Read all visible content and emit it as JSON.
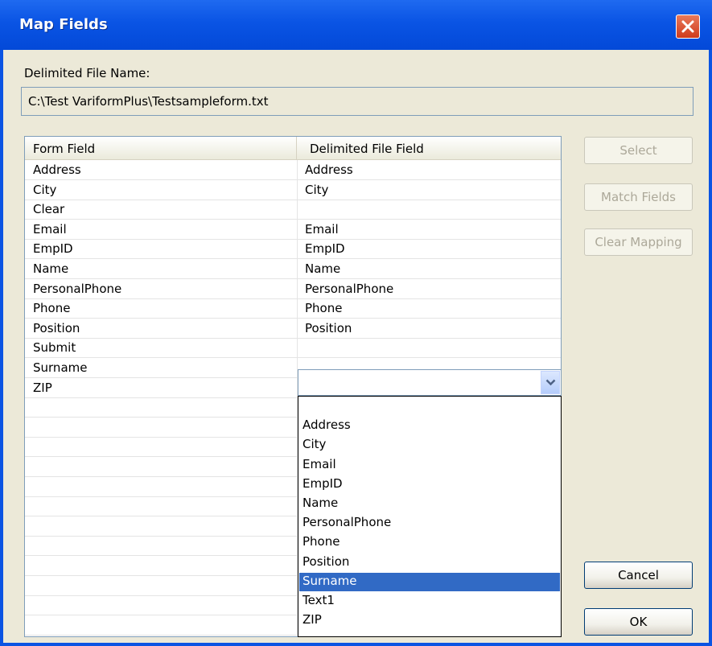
{
  "window": {
    "title": "Map Fields"
  },
  "file": {
    "label": "Delimited File Name:",
    "value": "C:\\Test VariformPlus\\Testsampleform.txt"
  },
  "grid": {
    "headers": [
      "Form Field",
      "Delimited File Field"
    ],
    "rows": [
      {
        "form": "Address",
        "file": "Address"
      },
      {
        "form": "City",
        "file": "City"
      },
      {
        "form": "Clear",
        "file": ""
      },
      {
        "form": "Email",
        "file": "Email"
      },
      {
        "form": "EmpID",
        "file": "EmpID"
      },
      {
        "form": "Name",
        "file": "Name"
      },
      {
        "form": "PersonalPhone",
        "file": "PersonalPhone"
      },
      {
        "form": "Phone",
        "file": "Phone"
      },
      {
        "form": "Position",
        "file": "Position"
      },
      {
        "form": "Submit",
        "file": ""
      },
      {
        "form": "Surname",
        "file": ""
      },
      {
        "form": "ZIP",
        "file": ""
      }
    ]
  },
  "dropdown": {
    "options": [
      "",
      "Address",
      "City",
      "Email",
      "EmpID",
      "Name",
      "PersonalPhone",
      "Phone",
      "Position",
      "Surname",
      "Text1",
      "ZIP"
    ],
    "selected": "Surname"
  },
  "buttons": {
    "select": "Select",
    "match": "Match Fields",
    "clear": "Clear Mapping",
    "cancel": "Cancel",
    "ok": "OK"
  },
  "colors": {
    "title_bar": "#0a54e4",
    "selection": "#316ac5",
    "dialog_bg": "#ece9d8"
  }
}
